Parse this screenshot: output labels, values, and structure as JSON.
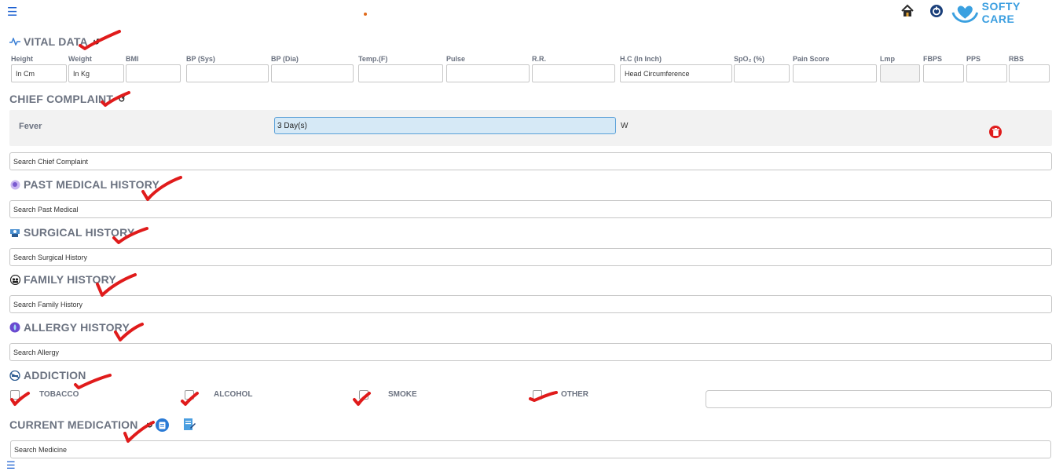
{
  "header": {
    "menu_icon": "hamburger-icon",
    "brand": "SOFTY CARE",
    "home_icon": "home-icon",
    "power_icon": "power-icon"
  },
  "vital": {
    "title": "VITAL DATA",
    "labels": [
      "Height",
      "Weight",
      "BMI",
      "BP (Sys)",
      "BP (Dia)",
      "Temp.(F)",
      "Pulse",
      "R.R.",
      "H.C (In Inch)",
      "SpO₂ (%)",
      "Pain Score",
      "Lmp",
      "FBPS",
      "PPS",
      "RBS"
    ],
    "placeholders": [
      "In Cm",
      "In Kg",
      "",
      "",
      "",
      "",
      "",
      "",
      "Head Circumference",
      "",
      "",
      "",
      "",
      "",
      ""
    ]
  },
  "chief": {
    "title": "CHIEF COMPLAINT",
    "complaint": "Fever",
    "duration": "3 Day(s)",
    "unit": "W",
    "search_placeholder": "Search Chief Complaint"
  },
  "past": {
    "title": "PAST MEDICAL HISTORY",
    "search_placeholder": "Search Past Medical"
  },
  "surgical": {
    "title": "SURGICAL HISTORY",
    "search_placeholder": "Search Surgical History"
  },
  "family": {
    "title": "FAMILY HISTORY",
    "search_placeholder": "Search Family History"
  },
  "allergy": {
    "title": "ALLERGY HISTORY",
    "search_placeholder": "Search Allergy"
  },
  "addiction": {
    "title": "ADDICTION",
    "items": [
      "TOBACCO",
      "ALCOHOL",
      "SMOKE",
      "OTHER"
    ]
  },
  "medication": {
    "title": "CURRENT MEDICATION",
    "search_placeholder": "Search Medicine"
  },
  "colors": {
    "accent": "#1a5fd0",
    "danger": "#e01b1b",
    "selected": "#d6e9f6"
  }
}
